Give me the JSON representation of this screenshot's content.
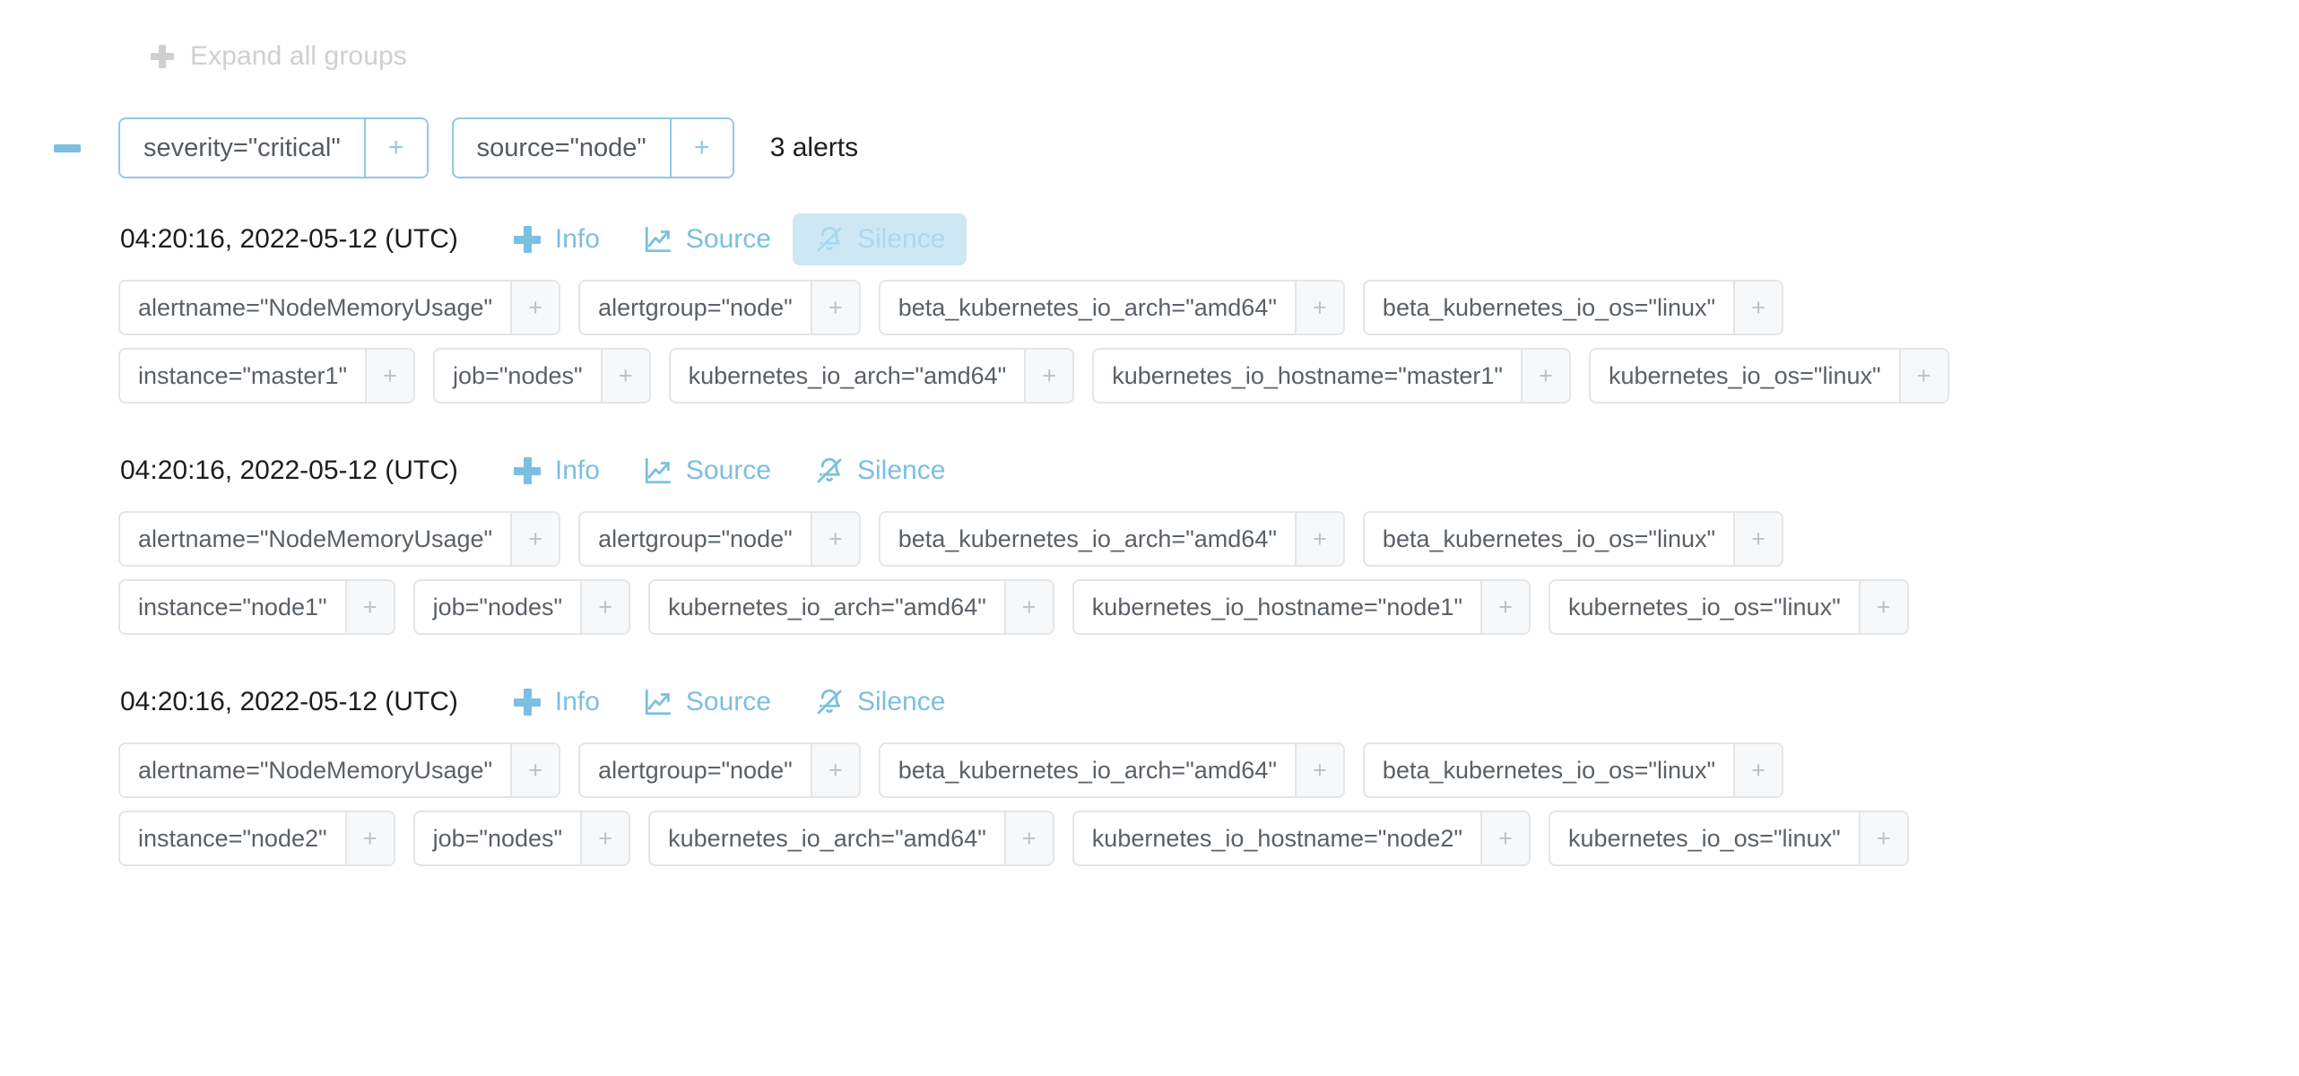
{
  "toolbar": {
    "expand_all_label": "Expand all groups",
    "expand_all_icon": "plus-icon"
  },
  "group": {
    "collapse_icon": "minus-icon",
    "collapsed": false,
    "filters": [
      {
        "text": "severity=\"critical\"",
        "add_label": "+"
      },
      {
        "text": "source=\"node\"",
        "add_label": "+"
      }
    ],
    "count_label": "3 alerts"
  },
  "actions": {
    "info_label": "Info",
    "info_icon": "plus-icon",
    "source_label": "Source",
    "source_icon": "chart-line-icon",
    "silence_label": "Silence",
    "silence_icon": "bell-slash-icon"
  },
  "colors": {
    "accent": "#7cbfe0",
    "accent_border": "#8fc9e6",
    "highlight_bg": "#cde8f4",
    "highlight_text": "#a9d9ee",
    "muted": "#cfcfcf",
    "chip_border": "#e3e5e7",
    "chip_text": "#5a6066"
  },
  "alerts": [
    {
      "timestamp": "04:20:16, 2022-05-12 (UTC)",
      "silence_highlighted": true,
      "label_rows": [
        [
          "alertname=\"NodeMemoryUsage\"",
          "alertgroup=\"node\"",
          "beta_kubernetes_io_arch=\"amd64\"",
          "beta_kubernetes_io_os=\"linux\""
        ],
        [
          "instance=\"master1\"",
          "job=\"nodes\"",
          "kubernetes_io_arch=\"amd64\"",
          "kubernetes_io_hostname=\"master1\"",
          "kubernetes_io_os=\"linux\""
        ]
      ]
    },
    {
      "timestamp": "04:20:16, 2022-05-12 (UTC)",
      "silence_highlighted": false,
      "label_rows": [
        [
          "alertname=\"NodeMemoryUsage\"",
          "alertgroup=\"node\"",
          "beta_kubernetes_io_arch=\"amd64\"",
          "beta_kubernetes_io_os=\"linux\""
        ],
        [
          "instance=\"node1\"",
          "job=\"nodes\"",
          "kubernetes_io_arch=\"amd64\"",
          "kubernetes_io_hostname=\"node1\"",
          "kubernetes_io_os=\"linux\""
        ]
      ]
    },
    {
      "timestamp": "04:20:16, 2022-05-12 (UTC)",
      "silence_highlighted": false,
      "label_rows": [
        [
          "alertname=\"NodeMemoryUsage\"",
          "alertgroup=\"node\"",
          "beta_kubernetes_io_arch=\"amd64\"",
          "beta_kubernetes_io_os=\"linux\""
        ],
        [
          "instance=\"node2\"",
          "job=\"nodes\"",
          "kubernetes_io_arch=\"amd64\"",
          "kubernetes_io_hostname=\"node2\"",
          "kubernetes_io_os=\"linux\""
        ]
      ]
    }
  ],
  "chip_add_label": "+"
}
